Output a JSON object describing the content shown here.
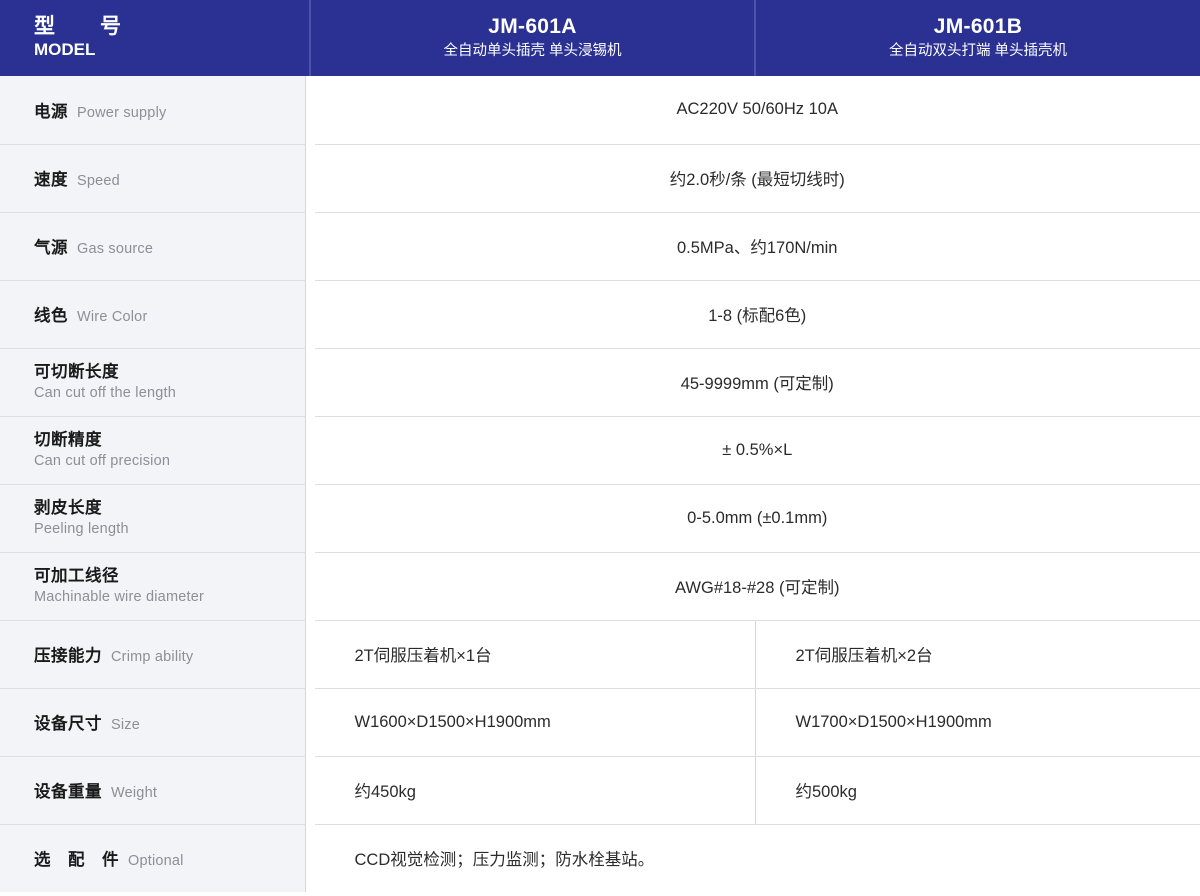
{
  "header": {
    "model_label_cn": "型　　号",
    "model_label_en": "MODEL",
    "columns": [
      {
        "name": "JM-601A",
        "subtitle": "全自动单头插壳 单头浸锡机"
      },
      {
        "name": "JM-601B",
        "subtitle": "全自动双头打端 单头插壳机"
      }
    ]
  },
  "colors": {
    "header_blue": "#2a3193",
    "label_background": "#f3f4f7",
    "row_border": "#dcdee3"
  },
  "rows": [
    {
      "label_cn": "电源",
      "label_en": "Power supply",
      "layout": "inline",
      "merged": true,
      "value": "AC220V 50/60Hz 10A"
    },
    {
      "label_cn": "速度",
      "label_en": "Speed",
      "layout": "inline",
      "merged": true,
      "value": "约2.0秒/条 (最短切线时)"
    },
    {
      "label_cn": "气源",
      "label_en": "Gas source",
      "layout": "inline",
      "merged": true,
      "value": "0.5MPa、约170N/min"
    },
    {
      "label_cn": "线色",
      "label_en": "Wire Color",
      "layout": "inline",
      "merged": true,
      "value": "1-8 (标配6色)"
    },
    {
      "label_cn": "可切断长度",
      "label_en": "Can cut off the length",
      "layout": "stack",
      "merged": true,
      "value": "45-9999mm (可定制)"
    },
    {
      "label_cn": "切断精度",
      "label_en": "Can cut off precision",
      "layout": "stack",
      "merged": true,
      "value": "± 0.5%×L"
    },
    {
      "label_cn": "剥皮长度",
      "label_en": "Peeling length",
      "layout": "stack",
      "merged": true,
      "value": "0-5.0mm (±0.1mm)"
    },
    {
      "label_cn": "可加工线径",
      "label_en": "Machinable wire diameter",
      "layout": "stack",
      "merged": true,
      "value": "AWG#18-#28 (可定制)"
    },
    {
      "label_cn": "压接能力",
      "label_en": "Crimp ability",
      "layout": "inline",
      "merged": false,
      "value_a": "2T伺服压着机×1台",
      "value_b": "2T伺服压着机×2台"
    },
    {
      "label_cn": "设备尺寸",
      "label_en": "Size",
      "layout": "inline",
      "merged": false,
      "value_a": "W1600×D1500×H1900mm",
      "value_b": "W1700×D1500×H1900mm"
    },
    {
      "label_cn": "设备重量",
      "label_en": "Weight",
      "layout": "inline",
      "merged": false,
      "value_a": "约450kg",
      "value_b": "约500kg"
    },
    {
      "label_cn": "选　配　件",
      "label_en": "Optional",
      "layout": "inline",
      "merged": true,
      "align": "left",
      "value": "CCD视觉检测；压力监测；防水栓基站。"
    }
  ]
}
